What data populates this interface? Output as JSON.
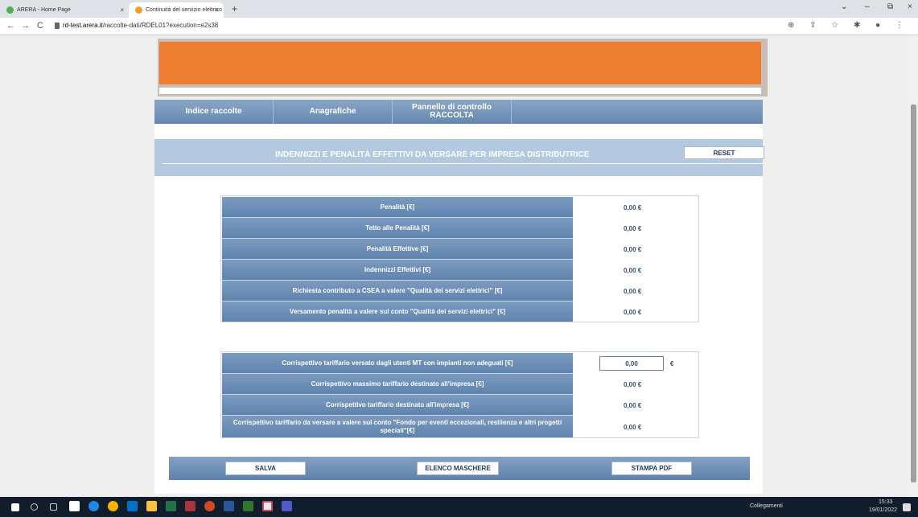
{
  "browser": {
    "tabs": [
      {
        "label": "ARERA - Home Page",
        "close": "×"
      },
      {
        "label": "Continuità del servizio elettrico",
        "close": "×"
      }
    ],
    "new_tab": "+",
    "window_controls": {
      "minimize": "–",
      "maximize": "⧉",
      "close": "×",
      "tabsearch": "⌄"
    },
    "nav": {
      "back": "←",
      "forward": "→",
      "reload": "C"
    },
    "url_domain": "rd-test.arera.it",
    "url_path": "/raccolte-dati/RDEL01?execution=e2s38",
    "toolbar_icons": "⊕ ⇪ ☆ ✱ ● ⋮"
  },
  "nav_menu": {
    "items": [
      {
        "label": "Indice raccolte"
      },
      {
        "label": "Anagrafiche"
      },
      {
        "label": "Pannello di controllo RACCOLTA"
      }
    ]
  },
  "heading": {
    "title": "INDENNIZZI E PENALITÀ EFFETTIVI DA VERSARE PER IMPRESA DISTRIBUTRICE",
    "reset_label": "RESET"
  },
  "table1": {
    "rows": [
      {
        "label": "Penalità [€]",
        "value": "0,00 €"
      },
      {
        "label": "Tetto alle Penalità [€]",
        "value": "0,00 €"
      },
      {
        "label": "Penalità Effettive [€]",
        "value": "0,00 €"
      },
      {
        "label": "Indennizzi Effettivi [€]",
        "value": "0,00 €"
      },
      {
        "label": "Richiesta contributo a CSEA a valere \"Qualità dei servizi elettrici\" [€]",
        "value": "0,00 €"
      },
      {
        "label": "Versamento penalità a valere sul conto \"Qualità dei servizi elettrici\" [€]",
        "value": "0,00 €"
      }
    ]
  },
  "table2": {
    "rows": [
      {
        "label": "Corrispettivo tariffario versato dagli utenti MT con impianti non adeguati [€]",
        "input_value": "0,00",
        "unit": "€"
      },
      {
        "label": "Corrispettivo massimo tariffario destinato all'impresa [€]",
        "value": "0,00 €"
      },
      {
        "label": "Corrispettivo tariffario destinato all'impresa [€]",
        "value": "0,00 €"
      },
      {
        "label": "Corrispettivo tariffario da versare a valere sul conto \"Fondo per eventi eccezionali, resilienza e altri progetti speciali\"[€]",
        "value": "0,00 €"
      }
    ]
  },
  "footer": {
    "save_label": "SALVA",
    "list_label": "ELENCO MASCHERE",
    "pdf_label": "STAMPA PDF"
  },
  "taskbar": {
    "links_label": "Collegamenti",
    "time": "15:33",
    "date": "19/01/2022",
    "icons": [
      "windows-icon",
      "search-icon",
      "task-view-icon",
      "mail-icon",
      "ie-icon",
      "chrome-icon",
      "outlook-icon",
      "explorer-icon",
      "excel-icon",
      "access-icon",
      "powerpoint-icon",
      "word-icon",
      "project-icon",
      "snip-icon",
      "teams-icon"
    ]
  },
  "colors": {
    "banner": "#ed7d31",
    "nav": "#6488b0",
    "heading_bg": "#b3c9e0",
    "label_cell": "#5f84ad"
  }
}
